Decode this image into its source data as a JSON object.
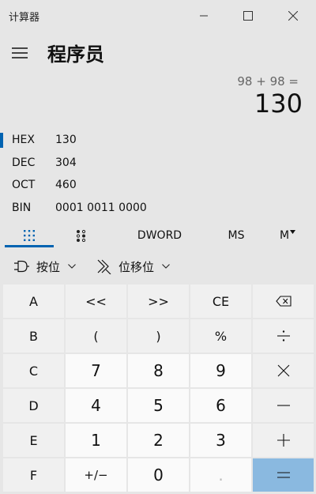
{
  "window": {
    "title": "计算器"
  },
  "header": {
    "mode_title": "程序员"
  },
  "display": {
    "expression": "98 + 98 =",
    "result": "130"
  },
  "radix": [
    {
      "name": "HEX",
      "value": "130",
      "selected": true
    },
    {
      "name": "DEC",
      "value": "304",
      "selected": false
    },
    {
      "name": "OCT",
      "value": "460",
      "selected": false
    },
    {
      "name": "BIN",
      "value": "0001 0011 0000",
      "selected": false
    }
  ],
  "tabs": {
    "word_size": "DWORD",
    "memory_store": "MS",
    "memory_menu": "M"
  },
  "bitops": {
    "bitwise_label": "按位",
    "bitshift_label": "位移位"
  },
  "keys": {
    "A": "A",
    "lshift": "<<",
    "rshift": ">>",
    "ce": "CE",
    "B": "B",
    "lparen": "(",
    "rparen": ")",
    "percent": "%",
    "C": "C",
    "n7": "7",
    "n8": "8",
    "n9": "9",
    "D": "D",
    "n4": "4",
    "n5": "5",
    "n6": "6",
    "E": "E",
    "n1": "1",
    "n2": "2",
    "n3": "3",
    "F": "F",
    "negate": "+/−",
    "n0": "0",
    "decimal": "."
  },
  "icons": {
    "backspace": "backspace-icon",
    "divide": "divide-icon",
    "multiply": "multiply-icon",
    "minus": "minus-icon",
    "plus": "plus-icon",
    "equals": "equals-icon"
  },
  "colors": {
    "accent": "#0063b1",
    "equals_key": "#8ab9e0",
    "background": "#e6e6e6"
  }
}
